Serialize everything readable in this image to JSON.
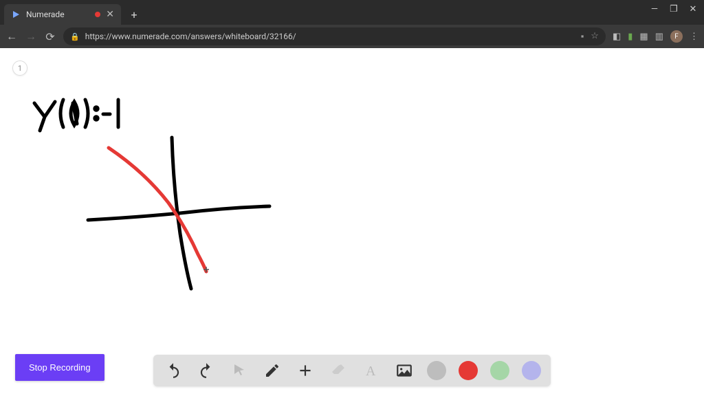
{
  "browser": {
    "tab_title": "Numerade",
    "url": "https://www.numerade.com/answers/whiteboard/32166/",
    "avatar_initial": "F"
  },
  "canvas": {
    "page_number": "1",
    "handwriting_label": "y(0) = -1"
  },
  "controls": {
    "stop_recording_label": "Stop Recording"
  },
  "toolbar": {
    "colors": {
      "gray": "#bdbdbd",
      "red": "#e53935",
      "green": "#a5d6a7",
      "purple": "#b4b4ec"
    }
  }
}
